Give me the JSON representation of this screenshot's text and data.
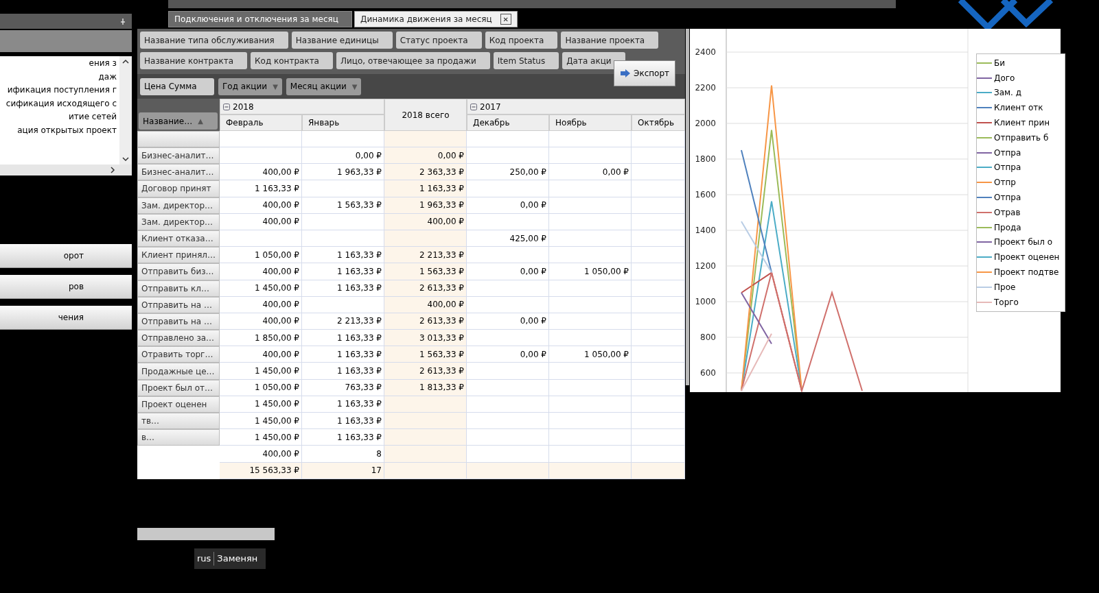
{
  "tabs": [
    {
      "label": "Подключения и отключения за месяц",
      "selected": false,
      "closable": false
    },
    {
      "label": "Динамика движения за месяц",
      "selected": true,
      "closable": true,
      "close_glyph": "✕"
    }
  ],
  "side_list": {
    "items": [
      "ения з",
      "даж",
      "ификация поступления г",
      "сификация исходящего с",
      "итие сетей",
      "ация открытых проект"
    ]
  },
  "side_nav": [
    "орот",
    "ров",
    "чения"
  ],
  "taskbar": [
    "rus",
    "Заменян"
  ],
  "pivot": {
    "filter_rows": [
      [
        "Название типа обслуживания",
        "Название единицы",
        "Статус проекта",
        "Код проекта",
        "Название проекта"
      ],
      [
        "Название контракта",
        "Код контракта",
        "Лицо, отвечающее за продажи",
        "Item Status",
        "Дата акци"
      ]
    ],
    "data_field": "Цена Сумма",
    "column_fields": [
      {
        "label": "Год акции",
        "sort_glyph": "▼"
      },
      {
        "label": "Месяц акции",
        "sort_glyph": "▼"
      }
    ],
    "row_field": {
      "label": "Название…",
      "sort_glyph": "▲"
    },
    "export_button": "Экспорт",
    "years": [
      {
        "label": "2018",
        "kind": "group",
        "expanded": true,
        "months": [
          "Февраль",
          "Январь"
        ]
      },
      {
        "label": "2018 всего",
        "kind": "total"
      },
      {
        "label": "2017",
        "kind": "group",
        "expanded": true,
        "months": [
          "Декабрь",
          "Ноябрь",
          "Октябрь"
        ]
      }
    ],
    "rows": [
      {
        "label": "Бизнес-аналит…",
        "cells": [
          null,
          "0,00 ₽",
          "0,00 ₽",
          null,
          null,
          null
        ]
      },
      {
        "label": "Бизнес-аналит…",
        "cells": [
          "400,00 ₽",
          "1 963,33 ₽",
          "2 363,33 ₽",
          "250,00 ₽",
          "0,00 ₽",
          null
        ]
      },
      {
        "label": "Договор принят",
        "cells": [
          "1 163,33 ₽",
          null,
          "1 163,33 ₽",
          null,
          null,
          null
        ]
      },
      {
        "label": "Зам. директор…",
        "cells": [
          "400,00 ₽",
          "1 563,33 ₽",
          "1 963,33 ₽",
          "0,00 ₽",
          null,
          null
        ]
      },
      {
        "label": "Зам. директор…",
        "cells": [
          "400,00 ₽",
          null,
          "400,00 ₽",
          null,
          null,
          null
        ]
      },
      {
        "label": "Клиент отказа…",
        "cells": [
          null,
          null,
          null,
          "425,00 ₽",
          null,
          null
        ]
      },
      {
        "label": "Клиент принял…",
        "cells": [
          "1 050,00 ₽",
          "1 163,33 ₽",
          "2 213,33 ₽",
          null,
          null,
          null
        ]
      },
      {
        "label": "Отправить биз…",
        "cells": [
          "400,00 ₽",
          "1 163,33 ₽",
          "1 563,33 ₽",
          "0,00 ₽",
          "1 050,00 ₽",
          null
        ]
      },
      {
        "label": "Отправить кл…",
        "cells": [
          "1 450,00 ₽",
          "1 163,33 ₽",
          "2 613,33 ₽",
          null,
          null,
          null
        ]
      },
      {
        "label": "Отправить на …",
        "cells": [
          "400,00 ₽",
          null,
          "400,00 ₽",
          null,
          null,
          null
        ]
      },
      {
        "label": "Отправить на …",
        "cells": [
          "400,00 ₽",
          "2 213,33 ₽",
          "2 613,33 ₽",
          "0,00 ₽",
          null,
          null
        ]
      },
      {
        "label": "Отправлено за…",
        "cells": [
          "1 850,00 ₽",
          "1 163,33 ₽",
          "3 013,33 ₽",
          null,
          null,
          null
        ]
      },
      {
        "label": "Отравить торг…",
        "cells": [
          "400,00 ₽",
          "1 163,33 ₽",
          "1 563,33 ₽",
          "0,00 ₽",
          "1 050,00 ₽",
          null
        ]
      },
      {
        "label": "Продажные це…",
        "cells": [
          "1 450,00 ₽",
          "1 163,33 ₽",
          "2 613,33 ₽",
          null,
          null,
          null
        ]
      },
      {
        "label": "Проект был от…",
        "cells": [
          "1 050,00 ₽",
          "763,33 ₽",
          "1 813,33 ₽",
          null,
          null,
          null
        ]
      },
      {
        "label": "Проект оценен",
        "cells": [
          "1 450,00 ₽",
          "1 163,33 ₽",
          null,
          null,
          null,
          null
        ]
      },
      {
        "label": "тв…",
        "cells": [
          "1 450,00 ₽",
          "1 163,33 ₽",
          null,
          null,
          null,
          null
        ]
      },
      {
        "label": "в…",
        "cells": [
          "1 450,00 ₽",
          "1 163,33 ₽",
          null,
          null,
          null,
          null
        ]
      },
      {
        "label": null,
        "cells": [
          "400,00 ₽",
          "8",
          null,
          null,
          null,
          null
        ]
      },
      {
        "label": null,
        "total": true,
        "cells": [
          "15 563,33 ₽",
          "17",
          null,
          null,
          null,
          null
        ]
      }
    ]
  },
  "chart": {
    "y_ticks": [
      "2400",
      "2200",
      "2000",
      "1800",
      "1600",
      "1400",
      "1200",
      "1000",
      "800",
      "600"
    ],
    "legend": [
      {
        "name": "Би",
        "color": "#9bbb59"
      },
      {
        "name": "Дого",
        "color": "#8064a2"
      },
      {
        "name": "Зам. д",
        "color": "#4bacc6"
      },
      {
        "name": "Клиент отк",
        "color": "#4f81bd"
      },
      {
        "name": "Клиент прин",
        "color": "#c0504d"
      },
      {
        "name": "Отправить б",
        "color": "#9bbb59"
      },
      {
        "name": "Отпра",
        "color": "#8064a2"
      },
      {
        "name": "Отпра",
        "color": "#4bacc6"
      },
      {
        "name": "Отпр",
        "color": "#f79646"
      },
      {
        "name": "Отпра",
        "color": "#4f81bd"
      },
      {
        "name": "Отрав",
        "color": "#d0706c"
      },
      {
        "name": "Прода",
        "color": "#9bbb59"
      },
      {
        "name": "Проект был о",
        "color": "#8064a2"
      },
      {
        "name": "Проект оценен",
        "color": "#4bacc6"
      },
      {
        "name": "Проект подтве",
        "color": "#f79646"
      },
      {
        "name": "Прое",
        "color": "#b9cde5"
      },
      {
        "name": "Торго",
        "color": "#e6b9b8"
      }
    ]
  }
}
